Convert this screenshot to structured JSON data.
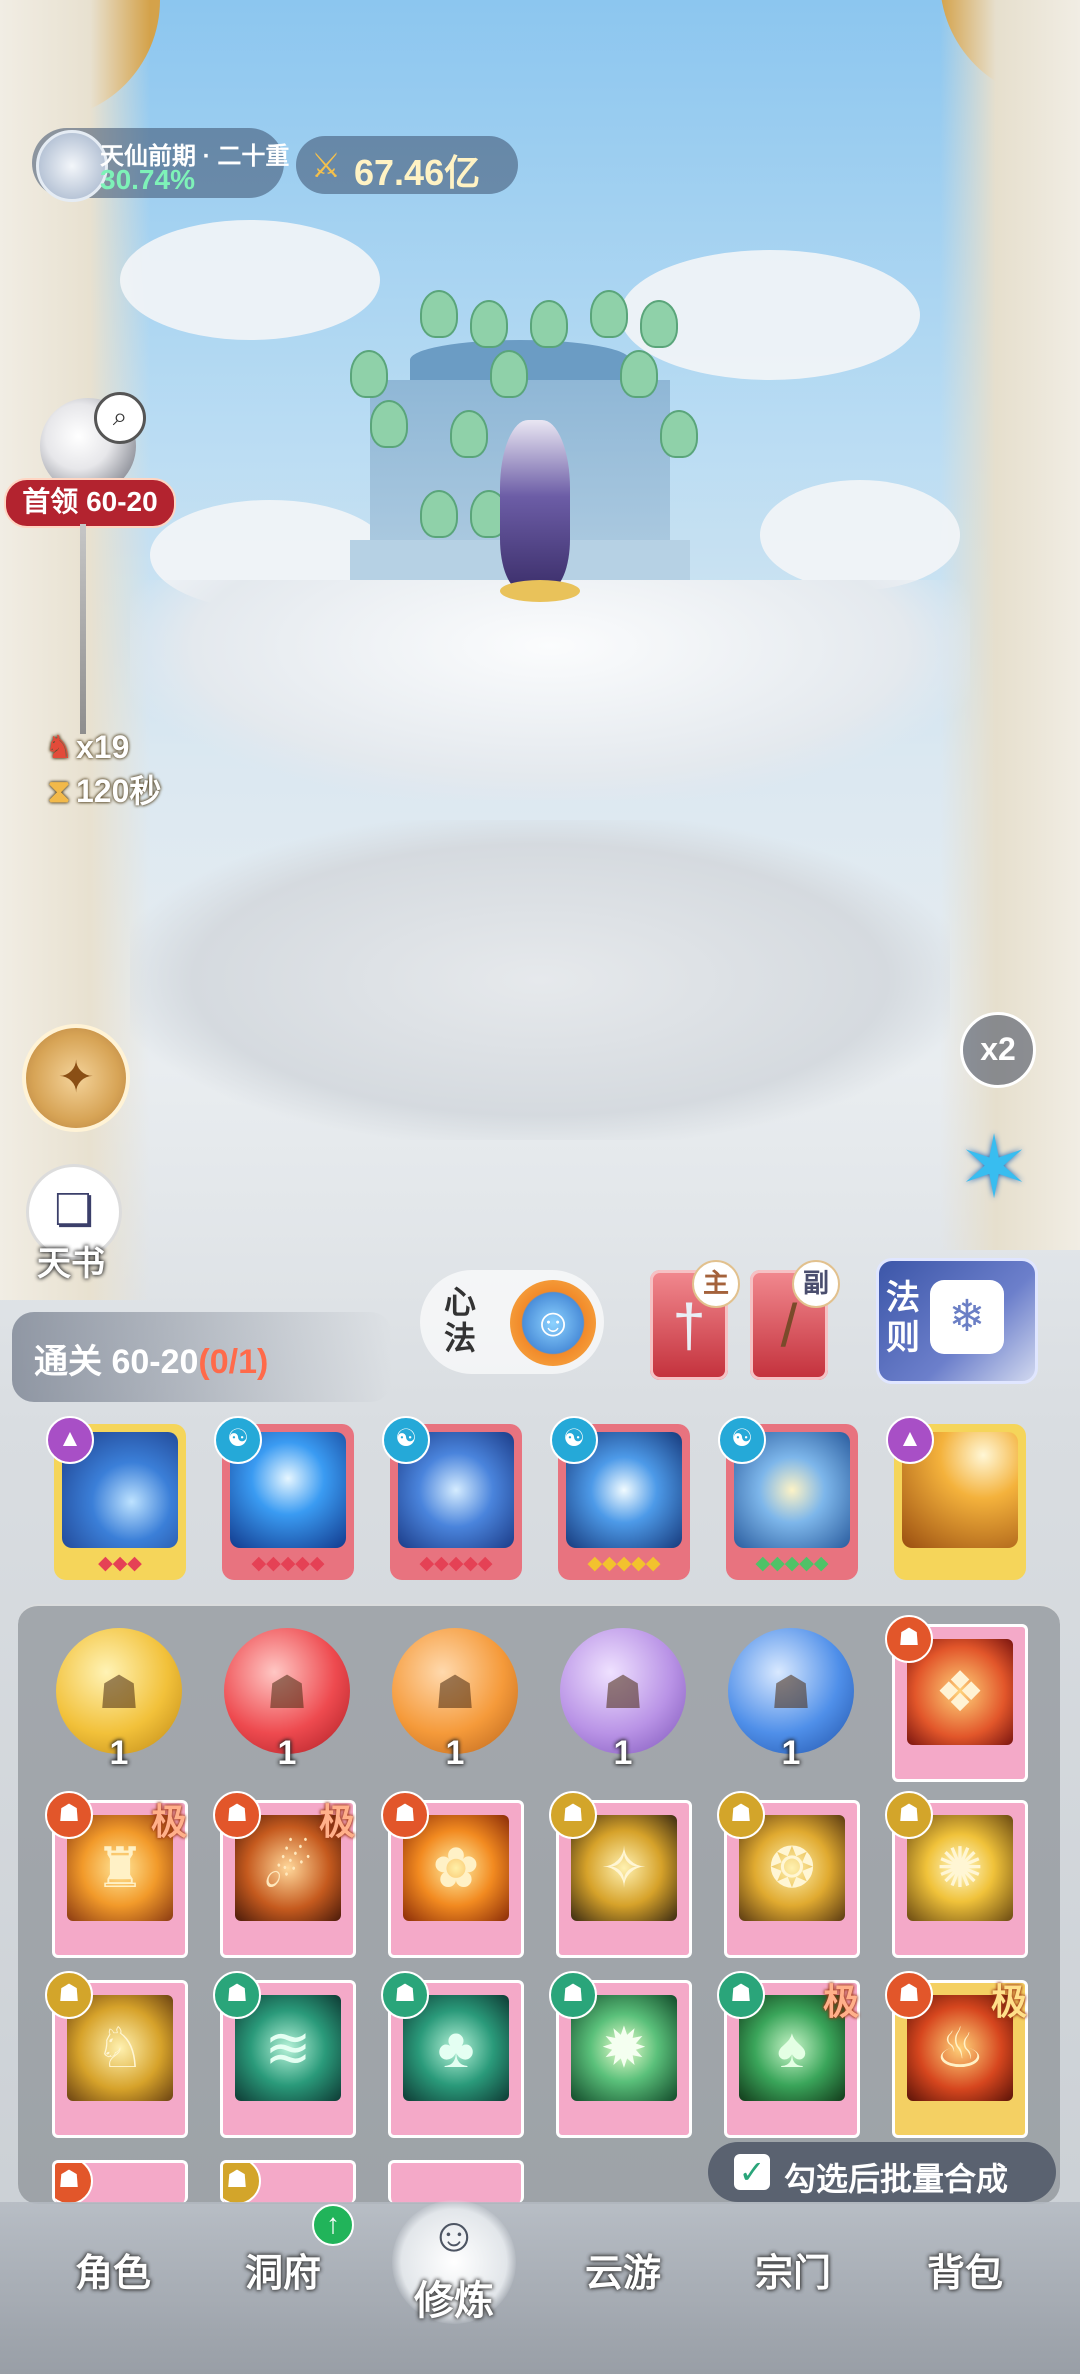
{
  "header": {
    "realm_name": "天仙前期 · 二十重",
    "realm_progress": "30.74%",
    "power_value": "67.46亿",
    "power_icon": "crossed-swords-icon"
  },
  "boss": {
    "label": "首领 60-20",
    "kill_count": "x19",
    "time_left": "120秒"
  },
  "side_left": {
    "book_label": "天书"
  },
  "side_right": {
    "speed_label": "x2"
  },
  "stage": {
    "clear_label": "通关 60-20",
    "clear_progress": "(0/1)"
  },
  "equipment": {
    "xinfa_label": "心法",
    "main_weapon_badge": "主",
    "sub_weapon_badge": "副",
    "fa_label": "法则"
  },
  "skills": [
    {
      "name": "skill-lightning-orb",
      "stars": "◆◆◆",
      "star_color": "#e54155",
      "tag": "▲"
    },
    {
      "name": "skill-thunder-storm",
      "stars": "◆◆◆◆◆",
      "star_color": "#e54155",
      "tag": "☯"
    },
    {
      "name": "skill-yin-yang-array",
      "stars": "◆◆◆◆◆",
      "star_color": "#e54155",
      "tag": "☯"
    },
    {
      "name": "skill-ice-sword",
      "stars": "◆◆◆◆◆",
      "star_color": "#f2c22e",
      "tag": "☯"
    },
    {
      "name": "skill-gold-coin-whirl",
      "stars": "◆◆◆◆◆",
      "star_color": "#4fc267",
      "tag": "☯"
    },
    {
      "name": "skill-golden-rays",
      "stars": "",
      "star_color": "#e54155",
      "tag": "▲"
    }
  ],
  "orbs": [
    {
      "count": "1",
      "color": "#f2c13a"
    },
    {
      "count": "1",
      "color": "#ee4a4f"
    },
    {
      "count": "1",
      "color": "#f59a3a"
    },
    {
      "count": "1",
      "color": "#b993e6"
    },
    {
      "count": "1",
      "color": "#4f8fe9"
    }
  ],
  "inventory_extreme_label": "极",
  "batch_merge": {
    "checkbox_mark": "✓",
    "label": "勾选后批量合成"
  },
  "nav": {
    "items": [
      "角色",
      "洞府",
      "修炼",
      "云游",
      "宗门",
      "背包"
    ],
    "active_index": 2,
    "up_badge": "↑"
  }
}
